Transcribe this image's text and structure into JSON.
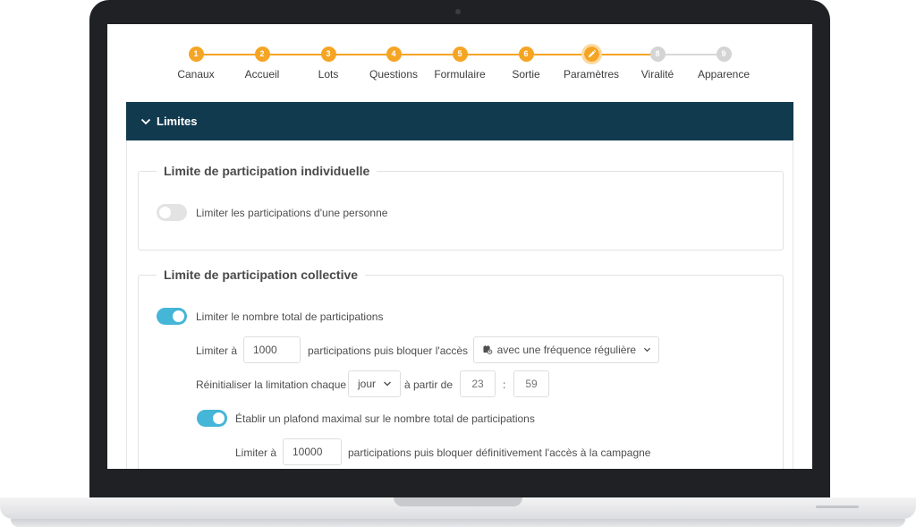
{
  "stepper": {
    "steps": [
      {
        "number": "1",
        "label": "Canaux",
        "state": "done"
      },
      {
        "number": "2",
        "label": "Accueil",
        "state": "done"
      },
      {
        "number": "3",
        "label": "Lots",
        "state": "done"
      },
      {
        "number": "4",
        "label": "Questions",
        "state": "done"
      },
      {
        "number": "5",
        "label": "Formulaire",
        "state": "done"
      },
      {
        "number": "6",
        "label": "Sortie",
        "state": "done"
      },
      {
        "number": "",
        "label": "Paramètres",
        "state": "current"
      },
      {
        "number": "8",
        "label": "Viralité",
        "state": "inactive"
      },
      {
        "number": "9",
        "label": "Apparence",
        "state": "inactive"
      }
    ],
    "active_color": "#f5a524",
    "inactive_color": "#d4d4d4"
  },
  "section": {
    "title": "Limites",
    "header_color": "#113a4f"
  },
  "individual": {
    "legend": "Limite de participation individuelle",
    "toggle_label": "Limiter les participations d'une personne",
    "toggle_on": false
  },
  "collective": {
    "legend": "Limite de participation collective",
    "toggle_label": "Limiter le nombre total de participations",
    "toggle_on": true,
    "limit_prefix": "Limiter à",
    "limit_value": "1000",
    "limit_suffix": "participations puis bloquer l'accès",
    "frequency_value": "avec une fréquence régulière",
    "reset_prefix": "Réinitialiser la limitation chaque",
    "reset_period": "jour",
    "from_label": "à partir de",
    "hour_placeholder": "23",
    "time_separator": ":",
    "minute_placeholder": "59",
    "cap_toggle_label": "Établir un plafond maximal sur le nombre total de participations",
    "cap_toggle_on": true,
    "cap_prefix": "Limiter à",
    "cap_value": "10000",
    "cap_suffix": "participations puis bloquer définitivement l'accès à la campagne",
    "toggle_color": "#45b5d8"
  }
}
